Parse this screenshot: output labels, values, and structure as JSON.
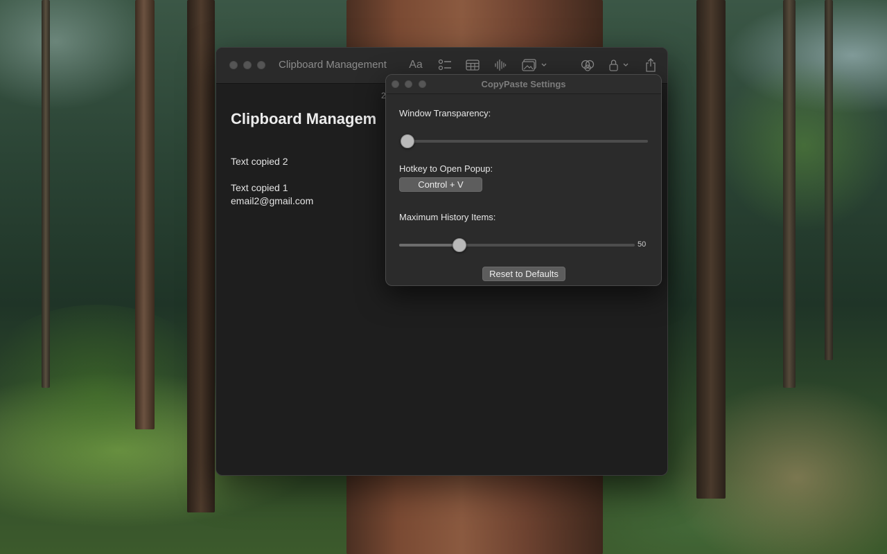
{
  "colors": {
    "window_background": "#1e1e1e",
    "toolbar_background": "#2a2a2a",
    "settings_background": "#2b2b2b",
    "button_background": "#5d5d5d",
    "text_primary": "#ececec",
    "text_muted": "#8c8c8c"
  },
  "main_window": {
    "title": "Clipboard Management",
    "toolbar_icons": {
      "format": "Aa",
      "checklist": "checklist-icon",
      "table": "table-icon",
      "audio": "audio-waveform-icon",
      "media": "media-icon",
      "collaborate": "collaborate-icon",
      "lock": "lock-icon",
      "share": "share-icon"
    },
    "note": {
      "date_fragment": "2",
      "title": "Clipboard Managem",
      "lines": [
        "Text copied 2",
        "Text copied 1",
        "email2@gmail.com"
      ]
    }
  },
  "settings": {
    "title": "CopyPaste Settings",
    "transparency_label": "Window Transparency:",
    "transparency_level": 0,
    "hotkey_label": "Hotkey to Open Popup:",
    "hotkey_value": "Control + V",
    "history_label": "Maximum History Items:",
    "history_value": "50",
    "history_slider_fraction": 0.24,
    "reset_label": "Reset to Defaults"
  }
}
